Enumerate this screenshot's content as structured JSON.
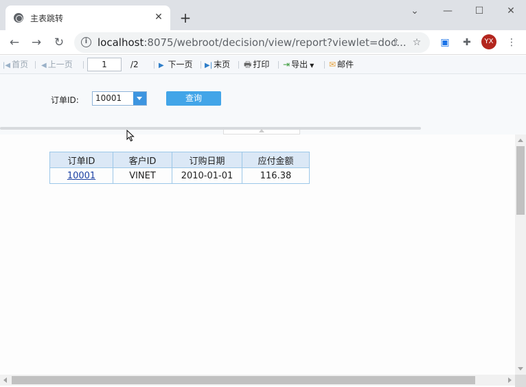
{
  "browser": {
    "tab_title": "主表跳转",
    "tab_close": "✕",
    "new_tab": "+",
    "url_host": "localhost",
    "url_rest": ":8075/webroot/decision/view/report?viewlet=doc...",
    "avatar_initials": "YX",
    "icons": [
      "globe-icon",
      "back-arrow-icon",
      "forward-arrow-icon",
      "reload-icon",
      "info-icon",
      "share-icon",
      "star-icon",
      "extension-icon",
      "puzzle-icon",
      "menu-dots-icon"
    ]
  },
  "toolbar": {
    "first_page": "首页",
    "prev_page": "上一页",
    "page_input": "1",
    "page_total": "/2",
    "next_page": "下一页",
    "last_page": "末页",
    "print": "打印",
    "export": "导出",
    "email": "邮件"
  },
  "params": {
    "order_id_label": "订单ID:",
    "order_id_value": "10001",
    "query_button": "查询"
  },
  "report": {
    "headers": [
      "订单ID",
      "客户ID",
      "订购日期",
      "应付金额"
    ],
    "rows": [
      [
        "10001",
        "VINET",
        "2010-01-01",
        "116.38"
      ]
    ]
  },
  "colors": {
    "accent": "#42a5e8",
    "header_bg": "#dbe8f6",
    "border": "#9cc7e8",
    "link": "#1a3fa3"
  }
}
